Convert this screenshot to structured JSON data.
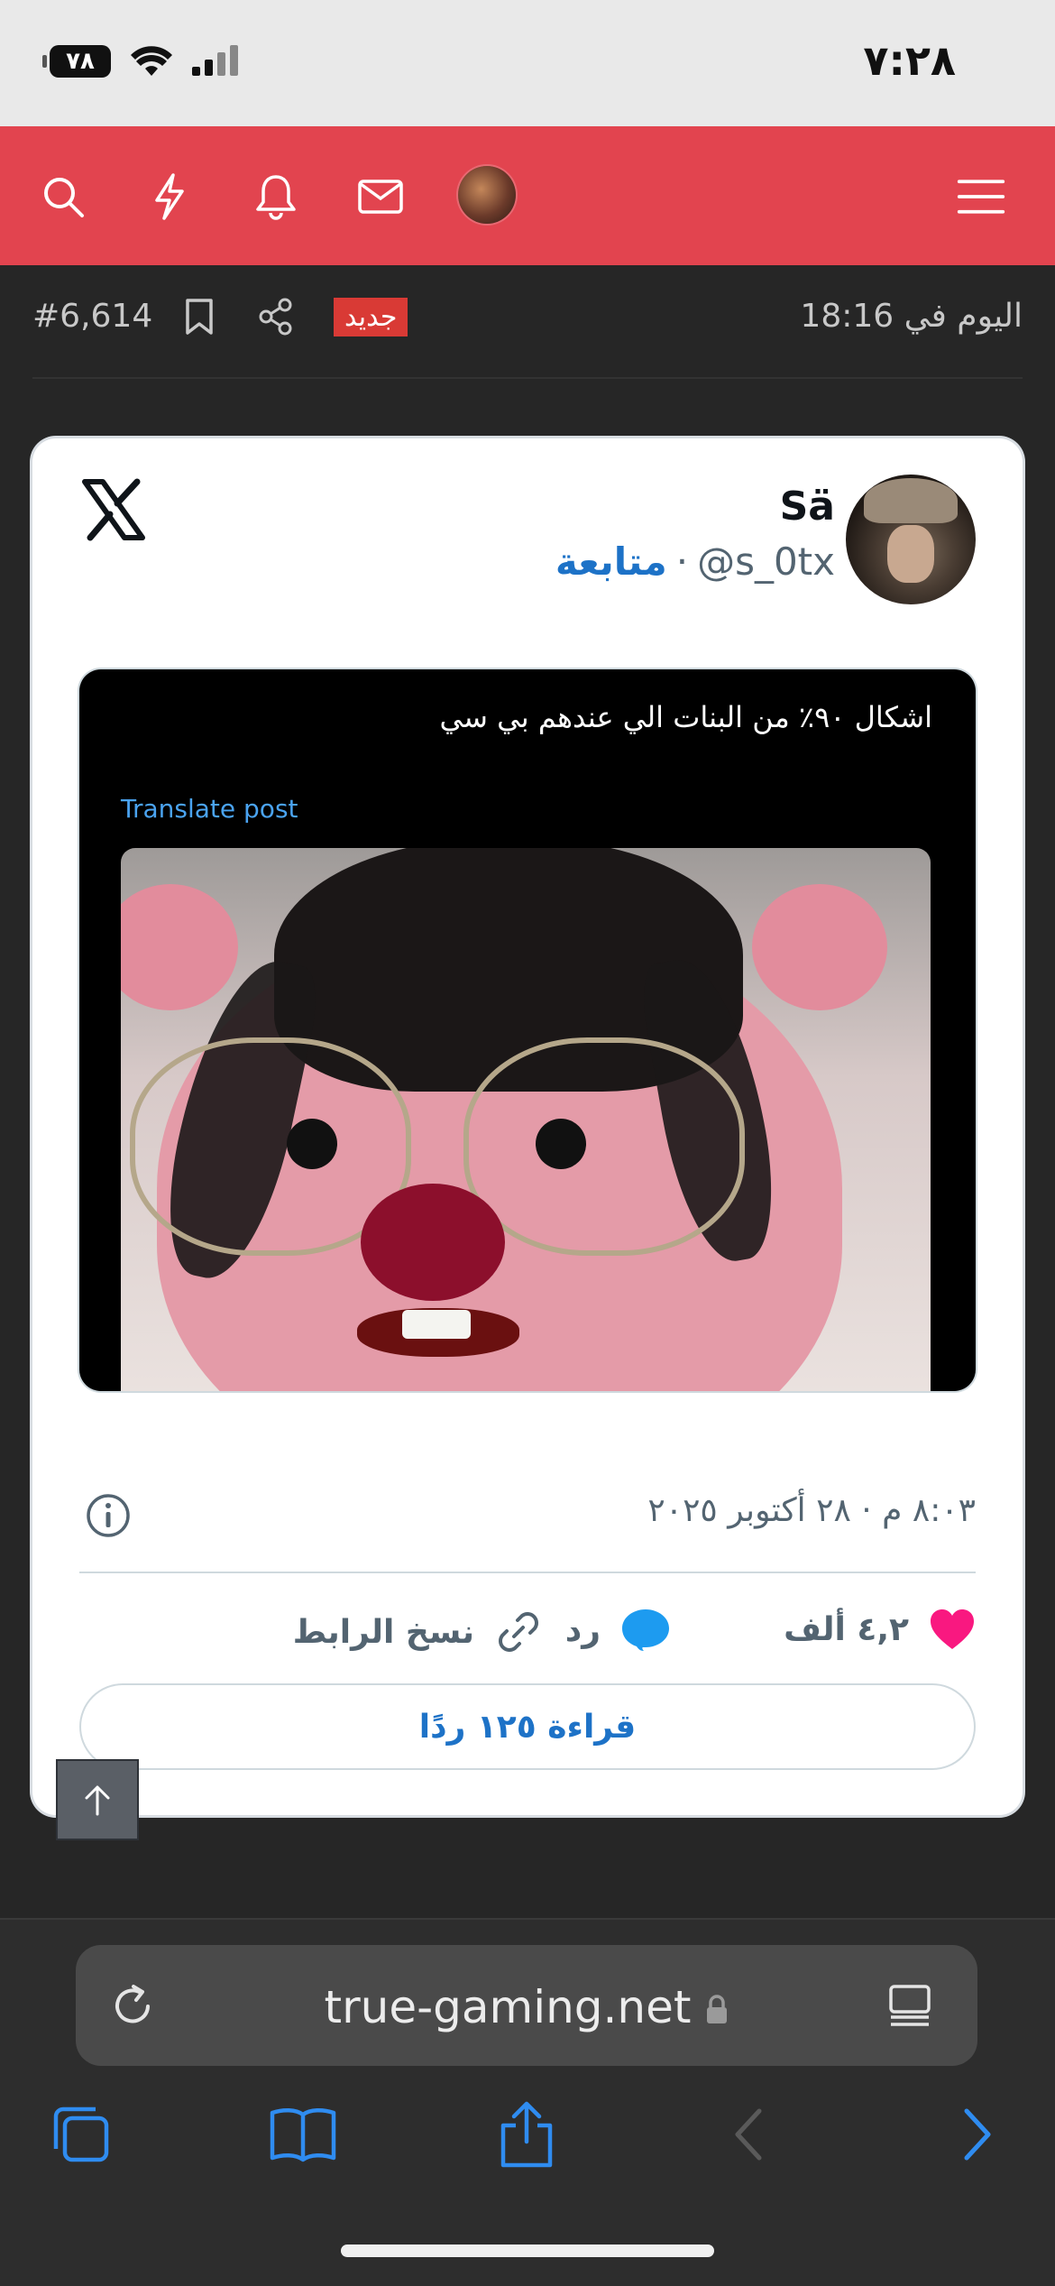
{
  "status_bar": {
    "time": "٧:٢٨",
    "battery": "٧٨"
  },
  "header": {
    "icons": [
      "search-icon",
      "lightning-icon",
      "bell-icon",
      "mail-icon",
      "avatar",
      "menu-icon"
    ]
  },
  "post_meta": {
    "number": "#6,614",
    "badge": "جديد",
    "date": "اليوم في 18:16"
  },
  "tweet": {
    "name": "Sä",
    "handle": "@s_0tx",
    "separator": "·",
    "follow": "متابعة",
    "text": "اشكال ٩٠٪ من البنات الي عندهم بي سي",
    "translate": "Translate post",
    "timestamp": "٨:٠٣ م · ٢٨ أكتوبر ٢٠٢٥",
    "likes": "٤,٢ ألف",
    "reply": "رد",
    "copy_link": "نسخ الرابط",
    "read_replies": "قراءة ١٢٥ ردًا"
  },
  "browser": {
    "url": "true-gaming.net"
  },
  "colors": {
    "header_red": "#e2444f",
    "link_blue": "#1d72c7",
    "like_pink": "#f91880",
    "reply_blue": "#1d9bf0",
    "toolbar_blue": "#2f8cf0"
  }
}
